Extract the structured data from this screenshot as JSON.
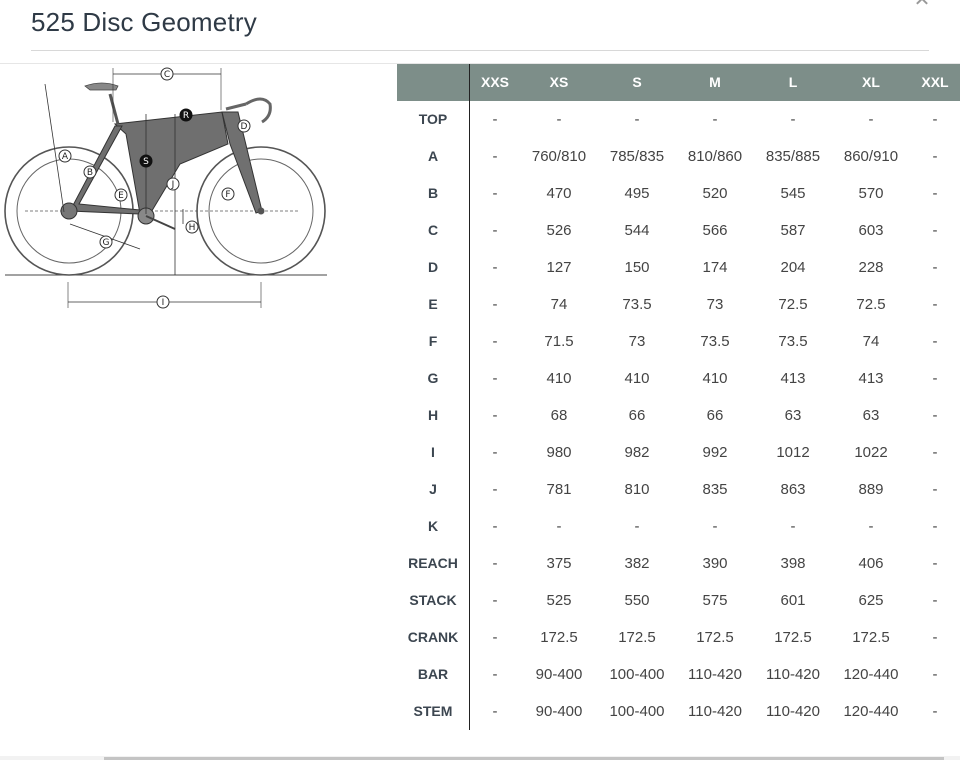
{
  "modal": {
    "title": "525 Disc Geometry",
    "close_icon": "close-icon"
  },
  "diagram": {
    "letters": [
      "A",
      "B",
      "C",
      "D",
      "E",
      "F",
      "G",
      "H",
      "I",
      "J",
      "R",
      "S"
    ]
  },
  "table": {
    "sizes": [
      "XXS",
      "XS",
      "S",
      "M",
      "L",
      "XL",
      "XXL"
    ],
    "rows": [
      {
        "label": "TOP",
        "values": [
          "-",
          "-",
          "-",
          "-",
          "-",
          "-",
          "-"
        ]
      },
      {
        "label": "A",
        "values": [
          "-",
          "760/810",
          "785/835",
          "810/860",
          "835/885",
          "860/910",
          "-"
        ]
      },
      {
        "label": "B",
        "values": [
          "-",
          "470",
          "495",
          "520",
          "545",
          "570",
          "-"
        ]
      },
      {
        "label": "C",
        "values": [
          "-",
          "526",
          "544",
          "566",
          "587",
          "603",
          "-"
        ]
      },
      {
        "label": "D",
        "values": [
          "-",
          "127",
          "150",
          "174",
          "204",
          "228",
          "-"
        ]
      },
      {
        "label": "E",
        "values": [
          "-",
          "74",
          "73.5",
          "73",
          "72.5",
          "72.5",
          "-"
        ]
      },
      {
        "label": "F",
        "values": [
          "-",
          "71.5",
          "73",
          "73.5",
          "73.5",
          "74",
          "-"
        ]
      },
      {
        "label": "G",
        "values": [
          "-",
          "410",
          "410",
          "410",
          "413",
          "413",
          "-"
        ]
      },
      {
        "label": "H",
        "values": [
          "-",
          "68",
          "66",
          "66",
          "63",
          "63",
          "-"
        ]
      },
      {
        "label": "I",
        "values": [
          "-",
          "980",
          "982",
          "992",
          "1012",
          "1022",
          "-"
        ]
      },
      {
        "label": "J",
        "values": [
          "-",
          "781",
          "810",
          "835",
          "863",
          "889",
          "-"
        ]
      },
      {
        "label": "K",
        "values": [
          "-",
          "-",
          "-",
          "-",
          "-",
          "-",
          "-"
        ]
      },
      {
        "label": "REACH",
        "values": [
          "-",
          "375",
          "382",
          "390",
          "398",
          "406",
          "-"
        ]
      },
      {
        "label": "STACK",
        "values": [
          "-",
          "525",
          "550",
          "575",
          "601",
          "625",
          "-"
        ]
      },
      {
        "label": "CRANK",
        "values": [
          "-",
          "172.5",
          "172.5",
          "172.5",
          "172.5",
          "172.5",
          "-"
        ]
      },
      {
        "label": "BAR",
        "values": [
          "-",
          "90-400",
          "100-400",
          "110-420",
          "110-420",
          "120-440",
          "-"
        ]
      },
      {
        "label": "STEM",
        "values": [
          "-",
          "90-400",
          "100-400",
          "110-420",
          "110-420",
          "120-440",
          "-"
        ]
      }
    ]
  },
  "colors": {
    "header_bg": "#7d8e89",
    "header_text": "#ffffff",
    "frame": "#6f6f6f",
    "title": "#2f3a46"
  }
}
